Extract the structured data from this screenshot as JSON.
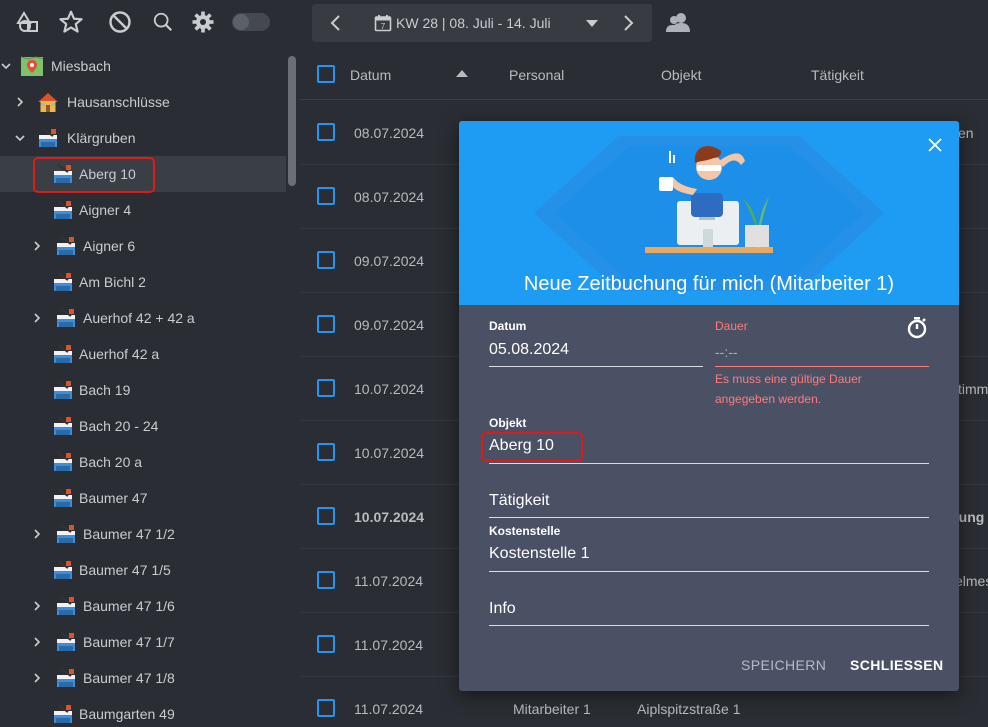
{
  "toolbar": {
    "week_label": "KW 28 | 08. Juli - 14. Juli"
  },
  "tree": {
    "root": "Miesbach",
    "items": [
      {
        "label": "Hausanschlüsse"
      },
      {
        "label": "Klärgruben"
      },
      {
        "label": "Aberg 10"
      },
      {
        "label": "Aigner 4"
      },
      {
        "label": "Aigner 6"
      },
      {
        "label": "Am Bichl 2"
      },
      {
        "label": "Auerhof 42 + 42 a"
      },
      {
        "label": "Auerhof 42 a"
      },
      {
        "label": "Bach 19"
      },
      {
        "label": "Bach 20 - 24"
      },
      {
        "label": "Bach 20 a"
      },
      {
        "label": "Baumer 47"
      },
      {
        "label": "Baumer 47 1/2"
      },
      {
        "label": "Baumer 47 1/5"
      },
      {
        "label": "Baumer 47 1/6"
      },
      {
        "label": "Baumer 47 1/7"
      },
      {
        "label": "Baumer 47 1/8"
      },
      {
        "label": "Baumgarten 49"
      }
    ]
  },
  "table": {
    "headers": {
      "datum": "Datum",
      "personal": "Personal",
      "objekt": "Objekt",
      "taetigkeit": "Tätigkeit"
    },
    "rows": [
      {
        "datum": "08.07.2024",
        "tail": "en"
      },
      {
        "datum": "08.07.2024",
        "tail": ""
      },
      {
        "datum": "09.07.2024",
        "tail": ""
      },
      {
        "datum": "09.07.2024",
        "tail": ""
      },
      {
        "datum": "10.07.2024",
        "tail": "timm"
      },
      {
        "datum": "10.07.2024",
        "tail": ""
      },
      {
        "datum": "10.07.2024",
        "tail": "tung"
      },
      {
        "datum": "11.07.2024",
        "tail": "elmes"
      },
      {
        "datum": "11.07.2024",
        "tail": ""
      },
      {
        "datum": "11.07.2024",
        "personal": "Mitarbeiter 1",
        "objekt": "Aiplspitzstraße 1",
        "tail": ""
      }
    ]
  },
  "modal": {
    "title": "Neue Zeitbuchung für mich (Mitarbeiter 1)",
    "datum_label": "Datum",
    "datum_value": "05.08.2024",
    "dauer_label": "Dauer",
    "dauer_placeholder": "--:--",
    "dauer_error": "Es muss eine gültige Dauer angegeben werden.",
    "objekt_label": "Objekt",
    "objekt_value": "Aberg 10",
    "taetigkeit_label": "Tätigkeit",
    "kostenstelle_label": "Kostenstelle",
    "kostenstelle_value": "Kostenstelle 1",
    "info_label": "Info",
    "save_label": "SPEICHERN",
    "close_label": "SCHLIESSEN"
  },
  "colors": {
    "accent": "#2196f3",
    "error": "#ff7b7b",
    "highlight": "#e01919"
  }
}
